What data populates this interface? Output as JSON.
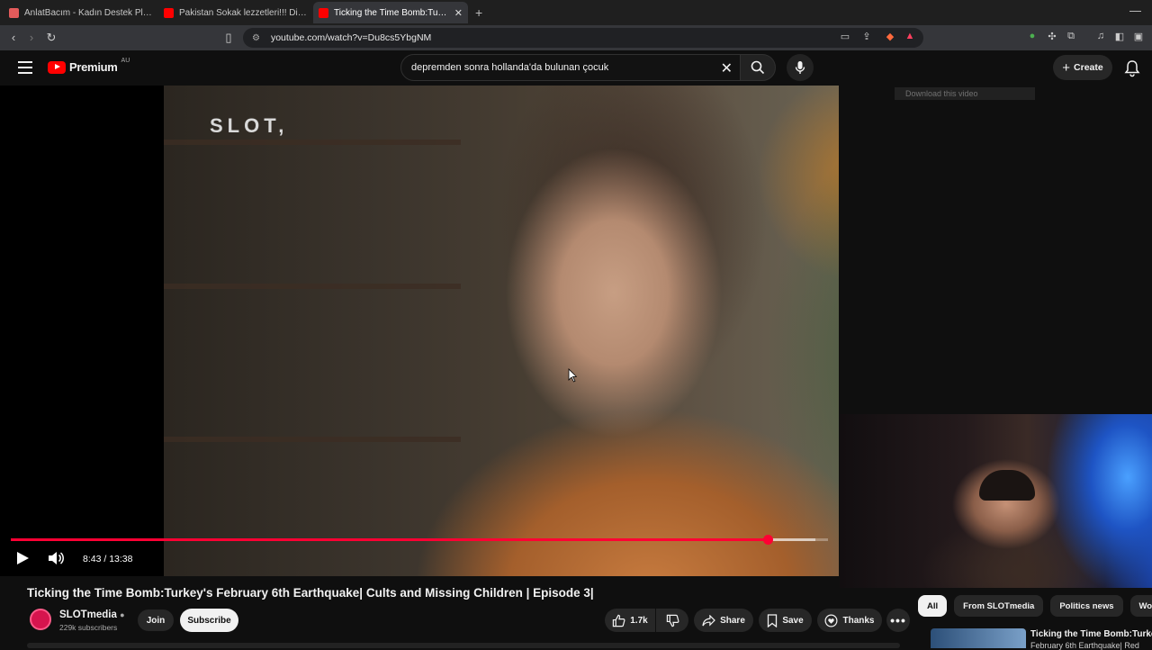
{
  "browser": {
    "tabs": [
      {
        "label": "AnlatBacım - Kadın Destek Platformu",
        "favicon_color": "#e45b5b"
      },
      {
        "label": "Pakistan Sokak lezzetleri!!! Diye diye",
        "favicon_color": "#ff0000"
      },
      {
        "label": "Ticking the Time Bomb:Turkey's",
        "favicon_color": "#ff0000",
        "active": true
      }
    ],
    "url": "youtube.com/watch?v=Du8cs5YbgNM"
  },
  "header": {
    "brand": "Premium",
    "region": "AU",
    "search_query": "depremden sonra hollanda'da bulunan çocuk",
    "create_label": "Create"
  },
  "player": {
    "watermark": "SLOT,",
    "download_label": "Download this video",
    "time": "8:43 / 13:38",
    "progress_fraction": 0.9266,
    "buffer_end_fraction": 0.985
  },
  "video": {
    "title": "Ticking the Time Bomb:Turkey's February 6th Earthquake| Cults and Missing Children | Episode 3|",
    "channel": "SLOTmedia",
    "subscribers": "229k subscribers",
    "join_label": "Join",
    "subscribe_label": "Subscribe",
    "likes": "1.7k",
    "share_label": "Share",
    "save_label": "Save",
    "thanks_label": "Thanks"
  },
  "chips": [
    "All",
    "From SLOTmedia",
    "Politics news",
    "Worl"
  ],
  "recommendation": {
    "title": "Ticking the Time Bomb:Turkey",
    "subtitle": "February 6th Earthquake| Red"
  },
  "colors": {
    "accent": "#ff0033",
    "brand": "#ff0000"
  }
}
